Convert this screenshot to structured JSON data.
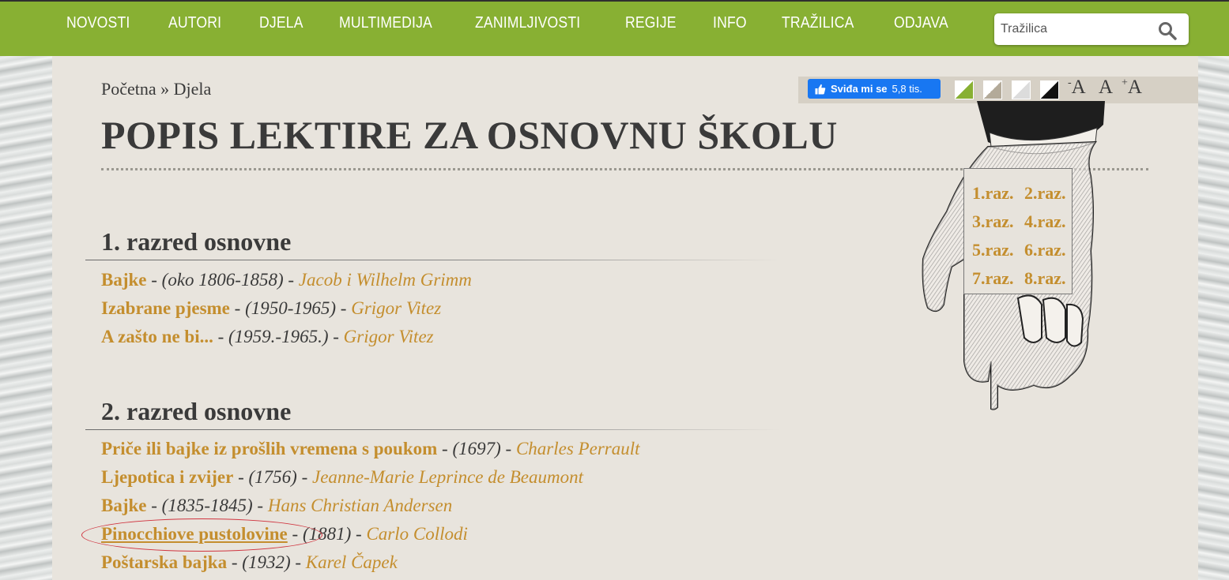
{
  "nav": {
    "items": [
      "NOVOSTI",
      "AUTORI",
      "DJELA",
      "MULTIMEDIJA",
      "ZANIMLJIVOSTI",
      "REGIJE",
      "INFO",
      "TRAŽILICA",
      "ODJAVA"
    ],
    "search_placeholder": "Tražilica",
    "search_icon": "search-icon"
  },
  "breadcrumb": {
    "home": "Početna",
    "separator": "»",
    "current": "Djela"
  },
  "social": {
    "like_label": "Sviđa mi se",
    "like_count": "5,8 tis."
  },
  "font_controls": {
    "decrease": "-A",
    "normal": "A",
    "increase": "+A"
  },
  "page_title": "POPIS LEKTIRE ZA OSNOVNU ŠKOLU",
  "grade_links": [
    "1.raz.",
    "2.raz.",
    "3.raz.",
    "4.raz.",
    "5.raz.",
    "6.raz.",
    "7.raz.",
    "8.raz."
  ],
  "sections": [
    {
      "heading": "1. razred osnovne",
      "entries": [
        {
          "work": "Bajke",
          "years": "(oko 1806-1858)",
          "author": "Jacob i Wilhelm Grimm"
        },
        {
          "work": "Izabrane pjesme",
          "years": "(1950-1965)",
          "author": "Grigor Vitez"
        },
        {
          "work": "A zašto ne bi...",
          "years": "(1959.-1965.)",
          "author": "Grigor Vitez"
        }
      ]
    },
    {
      "heading": "2. razred osnovne",
      "entries": [
        {
          "work": "Priče ili bajke iz prošlih vremena s poukom",
          "years": "(1697)",
          "author": "Charles Perrault"
        },
        {
          "work": "Ljepotica i zvijer",
          "years": "(1756)",
          "author": "Jeanne-Marie Leprince de Beaumont"
        },
        {
          "work": "Bajke",
          "years": "(1835-1845)",
          "author": "Hans Christian Andersen"
        },
        {
          "work": "Pinocchiove pustolovine",
          "years": "(1881)",
          "author": "Carlo Collodi"
        },
        {
          "work": "Poštarska bajka",
          "years": "(1932)",
          "author": "Karel Čapek"
        }
      ]
    }
  ],
  "separator_dash": "-",
  "colors": {
    "nav_bg": "#88b033",
    "panel_bg": "#e8e4dd",
    "link": "#c48e2e",
    "text": "#3a3a3a",
    "highlight": "#d0343f"
  }
}
